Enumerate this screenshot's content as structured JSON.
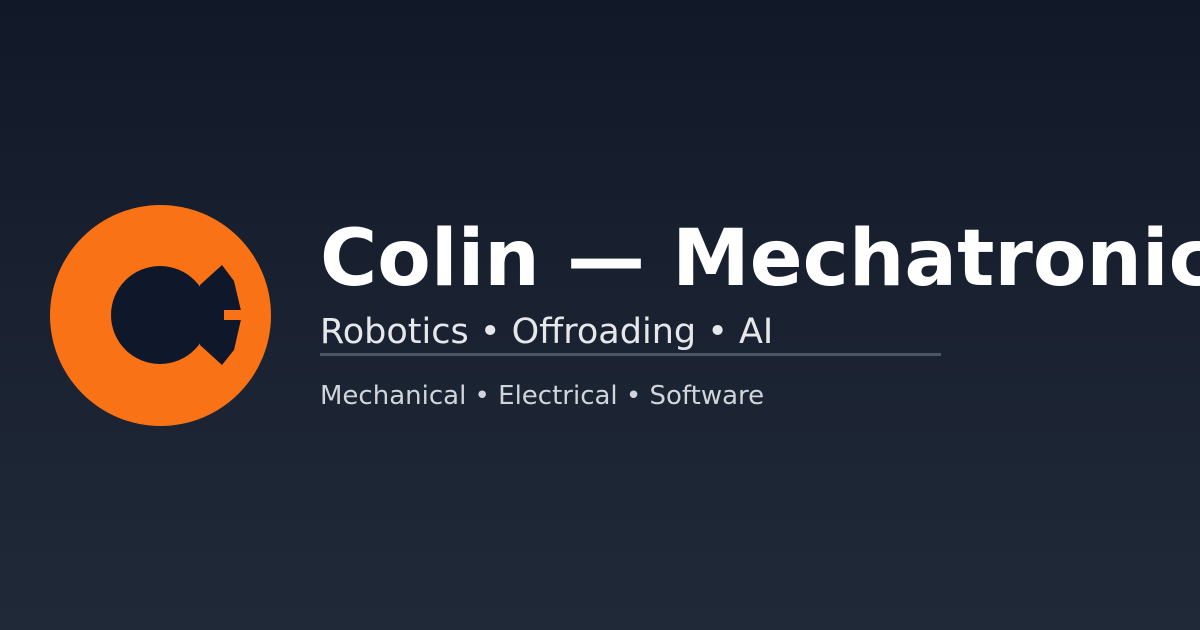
{
  "brand": {
    "logo_icon": "orange-ring-c-logo",
    "accent_color": "#f97316",
    "inner_color": "#0f172a"
  },
  "header": {
    "title": "Colin — Mechatronic",
    "subtitle": "Robotics • Offroading • AI",
    "tagline": "Mechanical • Electrical • Software"
  }
}
